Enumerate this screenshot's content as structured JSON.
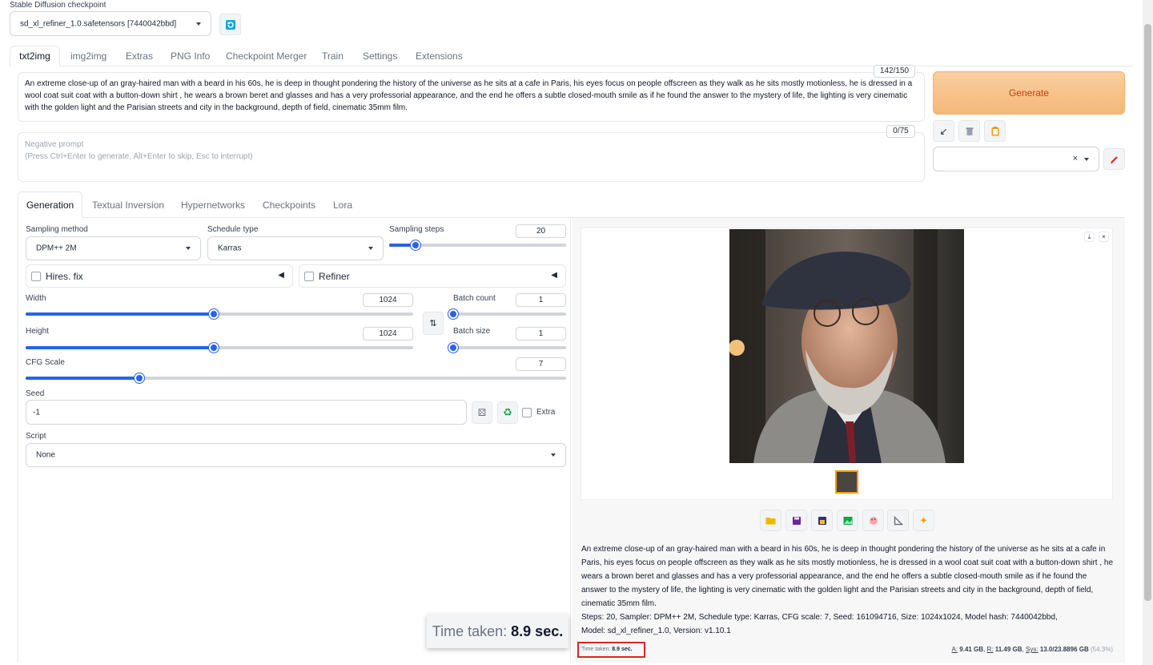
{
  "checkpoint": {
    "label": "Stable Diffusion checkpoint",
    "value": "sd_xl_refiner_1.0.safetensors [7440042bbd]"
  },
  "top_tabs": [
    {
      "label": "txt2img"
    },
    {
      "label": "img2img"
    },
    {
      "label": "Extras"
    },
    {
      "label": "PNG Info"
    },
    {
      "label": "Checkpoint Merger"
    },
    {
      "label": "Train"
    },
    {
      "label": "Settings"
    },
    {
      "label": "Extensions"
    }
  ],
  "prompt": {
    "text": "An extreme close-up of an gray-haired man with a beard in his 60s, he is deep in thought pondering the history of the universe as he sits at a cafe in Paris, his eyes focus on people offscreen as they walk as he sits mostly motionless, he is dressed in a wool coat suit coat with a button-down shirt , he wears a brown beret and glasses and has a very professorial appearance, and the end he offers a subtle closed-mouth smile as if he found the answer to the mystery of life, the lighting is very cinematic with the golden light and the Parisian streets and city in the background, depth of field, cinematic 35mm film.",
    "counter": "142/150"
  },
  "negative_prompt": {
    "line1": "Negative prompt",
    "line2": "(Press Ctrl+Enter to generate, Alt+Enter to skip, Esc to interrupt)",
    "counter": "0/75"
  },
  "generate_label": "Generate",
  "sub_tabs": [
    {
      "label": "Generation"
    },
    {
      "label": "Textual Inversion"
    },
    {
      "label": "Hypernetworks"
    },
    {
      "label": "Checkpoints"
    },
    {
      "label": "Lora"
    }
  ],
  "params": {
    "sampling_method_label": "Sampling method",
    "sampling_method": "DPM++ 2M",
    "schedule_type_label": "Schedule type",
    "schedule_type": "Karras",
    "sampling_steps_label": "Sampling steps",
    "sampling_steps": "20",
    "hires_label": "Hires. fix",
    "refiner_label": "Refiner",
    "width_label": "Width",
    "width": "1024",
    "height_label": "Height",
    "height": "1024",
    "batch_count_label": "Batch count",
    "batch_count": "1",
    "batch_size_label": "Batch size",
    "batch_size": "1",
    "cfg_label": "CFG Scale",
    "cfg": "7",
    "seed_label": "Seed",
    "seed": "-1",
    "extra_label": "Extra",
    "script_label": "Script",
    "script": "None"
  },
  "sliders": {
    "sampling_steps_fraction": 0.15,
    "width_fraction": 0.485,
    "height_fraction": 0.485,
    "batch_count_fraction": 0.0,
    "batch_size_fraction": 0.0,
    "cfg_fraction": 0.21
  },
  "output": {
    "info_text": "An extreme close-up of an gray-haired man with a beard in his 60s, he is deep in thought pondering the history of the universe as he sits at a cafe in Paris, his eyes focus on people offscreen as they walk as he sits mostly motionless, he is dressed in a wool coat suit coat with a button-down shirt , he wears a brown beret and glasses and has a very professorial appearance, and the end he offers a subtle closed-mouth smile as if he found the answer to the mystery of life, the lighting is very cinematic with the golden light and the Parisian streets and city in the background, depth of field, cinematic 35mm film.",
    "params_text": "Steps: 20, Sampler: DPM++ 2M, Schedule type: Karras, CFG scale: 7, Seed: 161094716, Size: 1024x1024, Model hash: 7440042bbd, Model: sd_xl_refiner_1.0, Version: v1.10.1",
    "time_small_label": "Time taken:",
    "time_value": "8.9 sec.",
    "time_big_label": "Time taken:",
    "vram_a_label": "A:",
    "vram_a": "9.41 GB",
    "vram_r_label": "R:",
    "vram_r": "11.49 GB",
    "vram_sys_label": "Sys:",
    "vram_sys": "13.0/23.8896 GB",
    "vram_pct": "(54.3%)"
  },
  "colors": {
    "accent": "#2563eb",
    "generate_bg": "#f7c48f",
    "generate_text": "#c2410c",
    "highlight_border": "#dc2626"
  }
}
